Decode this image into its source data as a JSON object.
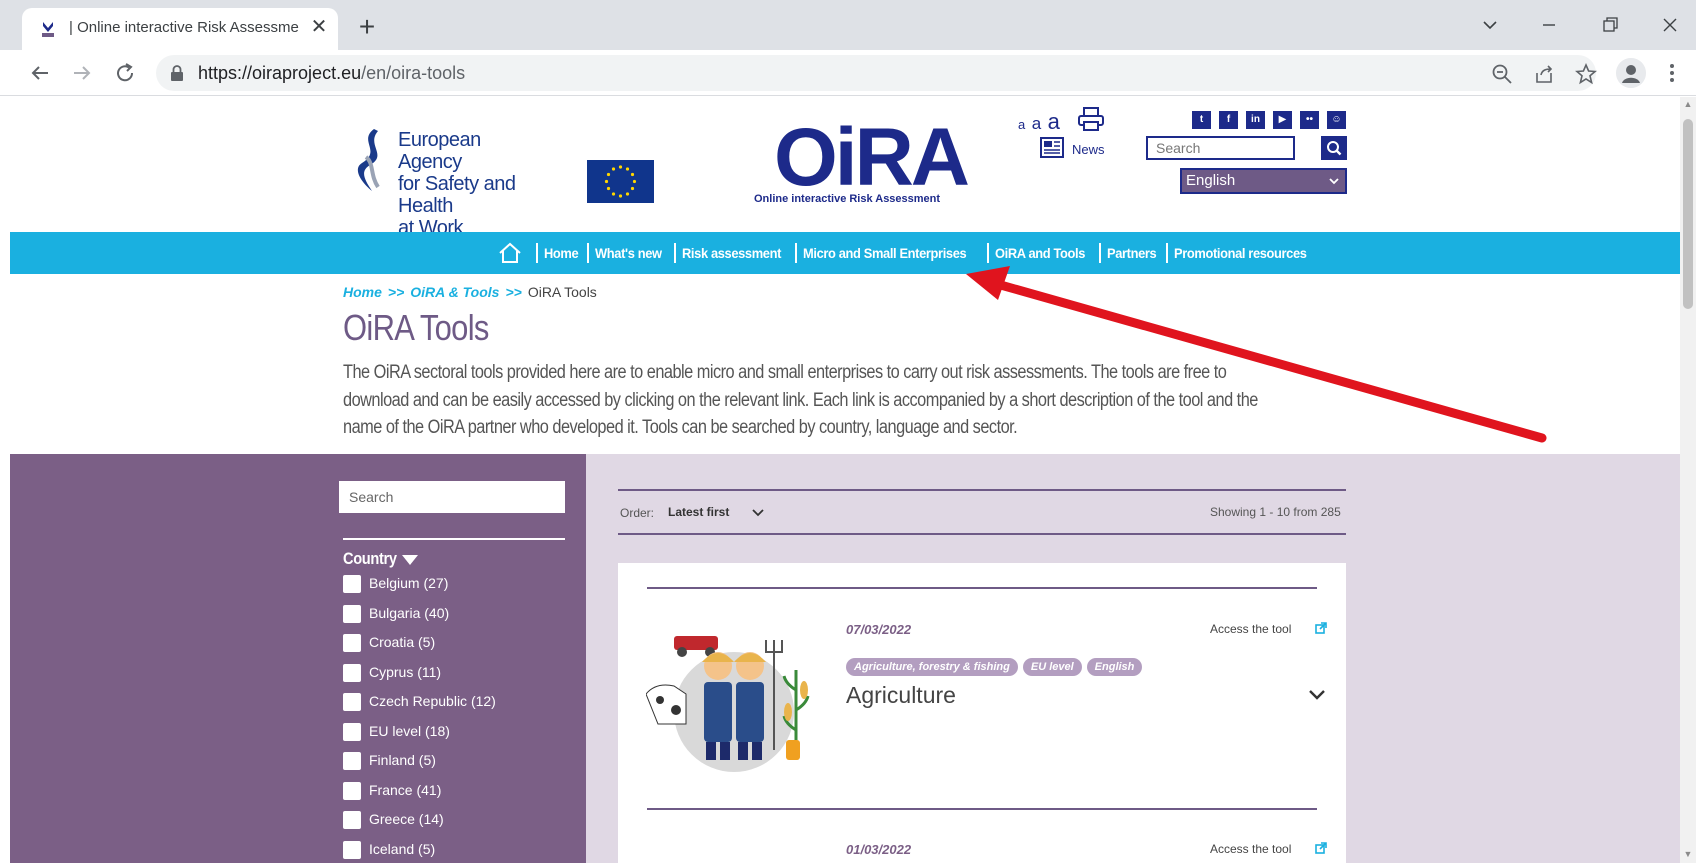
{
  "browser": {
    "tab_title": "| Online interactive Risk Assessme",
    "close_glyph": "✕",
    "newtab_glyph": "+",
    "url_host": "https://oiraproject.eu",
    "url_path": "/en/oira-tools"
  },
  "header": {
    "agency_line1": "European Agency",
    "agency_line2": "for Safety and Health",
    "agency_line3": "at Work",
    "oira_logo": "OiRA",
    "oira_subtitle": "Online interactive Risk Assessment",
    "font_sizes": [
      "a",
      "a",
      "a"
    ],
    "news_label": "News",
    "search_placeholder": "Search",
    "language": "English",
    "social_icons": [
      "twitter-icon",
      "facebook-icon",
      "linkedin-icon",
      "youtube-icon",
      "flickr-icon",
      "robot-icon"
    ]
  },
  "nav": {
    "items": [
      "Home",
      "What's new",
      "Risk assessment",
      "Micro and Small Enterprises",
      "OiRA and Tools",
      "Partners",
      "Promotional resources"
    ]
  },
  "breadcrumb": {
    "home": "Home",
    "sep": ">>",
    "section": "OiRA & Tools",
    "current": "OiRA Tools"
  },
  "page": {
    "title": "OiRA Tools",
    "intro": "The OiRA sectoral tools provided here are to enable micro and small enterprises to carry out risk assessments. The tools are free to download and can be easily accessed by clicking on the relevant link. Each link is accompanied by a short description of the tool and the name of the OiRA partner who developed it. Tools can be searched by country, language and sector."
  },
  "filters": {
    "search_placeholder": "Search",
    "country_heading": "Country",
    "countries": [
      "Belgium (27)",
      "Bulgaria (40)",
      "Croatia (5)",
      "Cyprus (11)",
      "Czech Republic (12)",
      "EU level (18)",
      "Finland (5)",
      "France (41)",
      "Greece (14)",
      "Iceland (5)"
    ]
  },
  "results": {
    "order_label": "Order:",
    "order_value": "Latest first",
    "showing": "Showing 1 - 10 from 285",
    "items": [
      {
        "date": "07/03/2022",
        "access": "Access the tool",
        "tags": [
          "Agriculture, forestry & fishing",
          "EU level",
          "English"
        ],
        "title": "Agriculture"
      },
      {
        "date": "01/03/2022",
        "access": "Access the tool"
      }
    ]
  },
  "colors": {
    "nav_blue": "#1ab0e0",
    "brand_navy": "#1d2a8a",
    "filter_purple": "#7b5f86",
    "results_lilac": "#e0d8e4",
    "arrow_red": "#e0141e"
  }
}
